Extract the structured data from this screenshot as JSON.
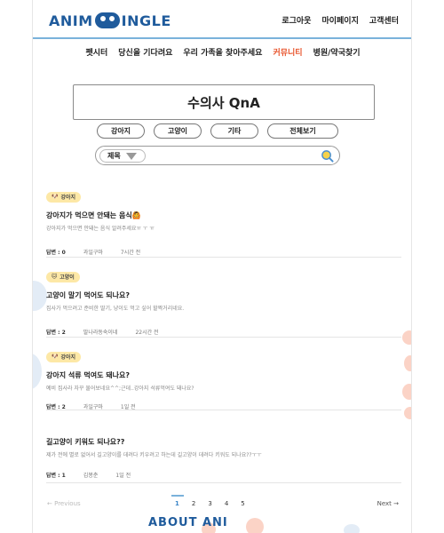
{
  "header": {
    "logo_left": "ANIM",
    "logo_right": "INGLE",
    "links": [
      "로그아웃",
      "마이페이지",
      "고객센터"
    ]
  },
  "nav": {
    "items": [
      "펫시터",
      "당신을 기다려요",
      "우리 가족을 찾아주세요",
      "커뮤니티",
      "병원/약국찾기"
    ],
    "active_index": 3
  },
  "page_title": "수의사 QnA",
  "categories": [
    "강아지",
    "고양이",
    "기타",
    "전체보기"
  ],
  "search": {
    "select_value": "제목",
    "placeholder": ""
  },
  "posts": [
    {
      "tag": "강아지",
      "title": "강아지가 먹으면 안돼는 음식🙆",
      "snippet": "강아지가 먹으면 안돼는 음식 알려주세요ㅠ ㅜ ㅠ",
      "answers": "답변 : 0",
      "author": "과일구마",
      "time": "7시간 전"
    },
    {
      "tag": "고양이",
      "title": "고양이 말기 먹어도 되나요?",
      "snippet": "집사가 먹으려고 준비한 딸기, 냥이도 먹고 싶어 할짝거리네요.",
      "answers": "답변 : 2",
      "author": "말나라동숙이네",
      "time": "22시간 전"
    },
    {
      "tag": "강아지",
      "title": "강아지 석류 먹여도 돼나요?",
      "snippet": "예비 집사라 자꾸 물어보네요^^;근데..강아지 석류먹여도 돼나요?",
      "answers": "답변 : 2",
      "author": "과일구마",
      "time": "1일 전"
    },
    {
      "tag": "",
      "title": "길고양이 키워도 되나요??",
      "snippet": "제가 전에 별로 없어서 길고양이를 데려다 키우려고 하는데 길고양이 데려다 키워도 되나요??ㅜㅜ",
      "answers": "답변 : 1",
      "author": "김봉춘",
      "time": "1일 전"
    }
  ],
  "pagination": {
    "prev": "← Previous",
    "next": "Next →",
    "pages": [
      "1",
      "2",
      "3",
      "4",
      "5"
    ],
    "current": "1"
  },
  "footer": {
    "logo_text": "ABOUT ANI"
  },
  "colors": {
    "brand": "#1f5b9c",
    "accent": "#e8542c",
    "tag_bg": "#fde8a6",
    "header_border": "#7ab2db"
  }
}
